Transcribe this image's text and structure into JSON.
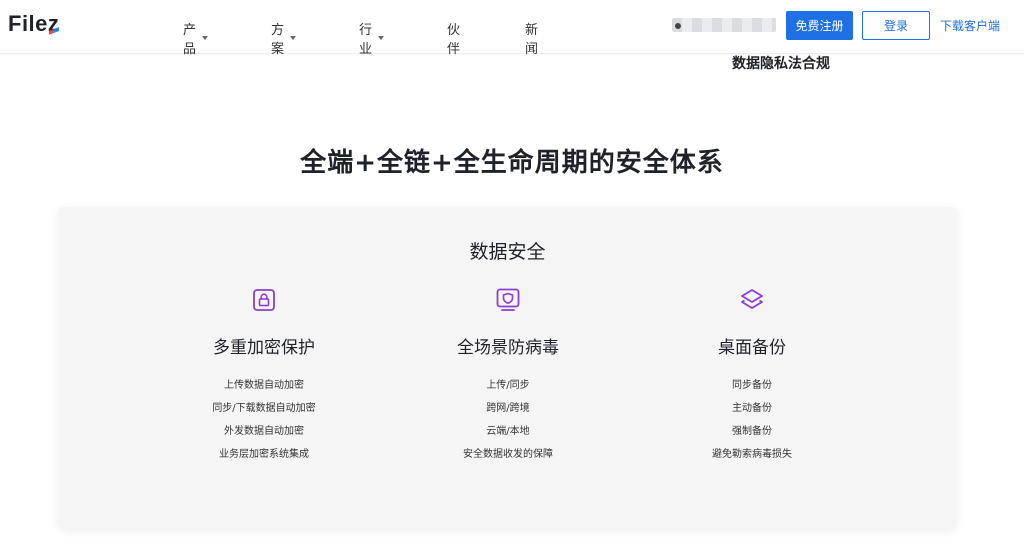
{
  "header": {
    "logo": "File",
    "logo_z": "z",
    "nav": [
      {
        "label": "产品",
        "has_dropdown": true
      },
      {
        "label": "方案",
        "has_dropdown": true
      },
      {
        "label": "行业",
        "has_dropdown": true
      },
      {
        "label": "伙伴",
        "has_dropdown": false
      },
      {
        "label": "新闻",
        "has_dropdown": false
      }
    ],
    "register_label": "免费注册",
    "login_label": "登录",
    "download_label": "下载客户端"
  },
  "privacy_text": "数据隐私法合规",
  "section_title": "全端+全链+全生命周期的安全体系",
  "card": {
    "title": "数据安全",
    "columns": [
      {
        "icon": "lock-icon",
        "title": "多重加密保护",
        "items": [
          "上传数据自动加密",
          "同步/下载数据自动加密",
          "外发数据自动加密",
          "业务层加密系统集成"
        ]
      },
      {
        "icon": "shield-icon",
        "title": "全场景防病毒",
        "items": [
          "上传/同步",
          "跨网/跨境",
          "云端/本地",
          "安全数据收发的保障"
        ]
      },
      {
        "icon": "layers-icon",
        "title": "桌面备份",
        "items": [
          "同步备份",
          "主动备份",
          "强制备份",
          "避免勒索病毒损失"
        ]
      }
    ]
  },
  "colors": {
    "accent": "#1f6fe5",
    "icon_purple": "#8a3fd1"
  }
}
